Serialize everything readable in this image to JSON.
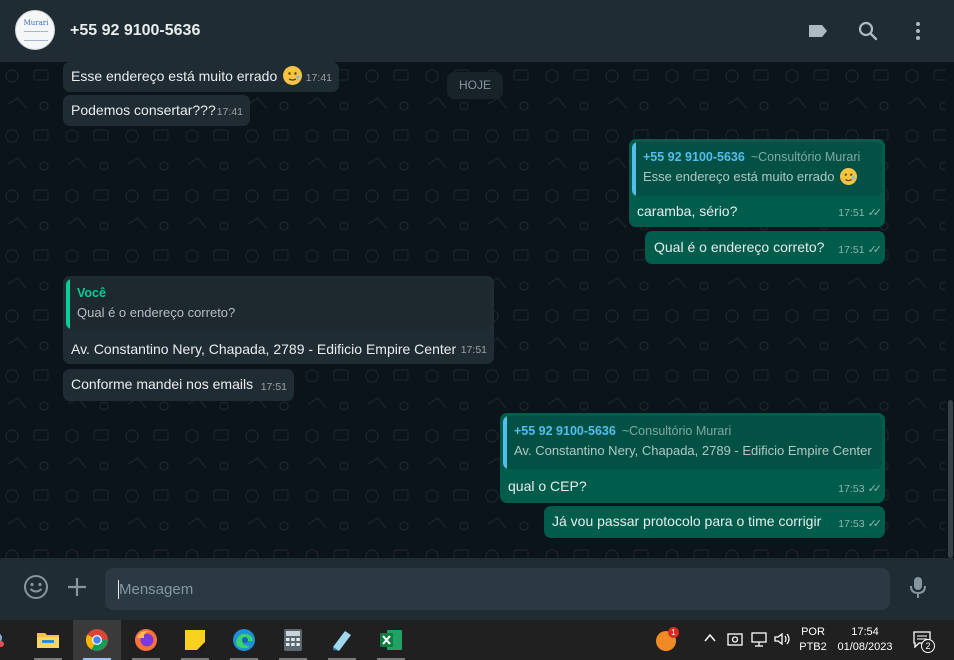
{
  "header": {
    "contact_name": "+55 92 9100-5636",
    "avatar_text": "Murari",
    "icons": [
      "label-icon",
      "search-icon",
      "menu-icon"
    ]
  },
  "chat": {
    "date_chip": "HOJE",
    "messages": [
      {
        "dir": "in",
        "text": "Esse endereço está muito errado",
        "emoji": "face-with-tear-icon",
        "time": "17:41"
      },
      {
        "dir": "in",
        "text": "Podemos consertar???",
        "time": "17:41"
      },
      {
        "dir": "out",
        "quote": {
          "author": "+55 92 9100-5636",
          "alias": "~Consultório Murari",
          "text": "Esse endereço está muito errado"
        },
        "text": "caramba, sério?",
        "time": "17:51",
        "status": "read"
      },
      {
        "dir": "out",
        "text": "Qual é o endereço correto?",
        "time": "17:51",
        "status": "read"
      },
      {
        "dir": "in",
        "quote": {
          "author": "Você",
          "text": "Qual é o endereço correto?"
        },
        "text": "Av. Constantino Nery, Chapada, 2789 - Edificio Empire Center",
        "time": "17:51"
      },
      {
        "dir": "in",
        "text": "Conforme mandei nos emails",
        "time": "17:51"
      },
      {
        "dir": "out",
        "quote": {
          "author": "+55 92 9100-5636",
          "alias": "~Consultório Murari",
          "text": "Av. Constantino Nery, Chapada, 2789 - Edificio Empire Center"
        },
        "text": "qual o CEP?",
        "time": "17:53",
        "status": "read"
      },
      {
        "dir": "out",
        "text": "Já vou passar protocolo para o time corrigir",
        "time": "17:53",
        "status": "read"
      }
    ]
  },
  "composer": {
    "placeholder": "Mensagem",
    "icons": [
      "emoji-icon",
      "attach-plus-icon",
      "microphone-icon"
    ]
  },
  "taskbar": {
    "apps": [
      "file-explorer-icon",
      "chrome-icon",
      "firefox-icon",
      "sticky-notes-icon",
      "edge-icon",
      "calculator-icon",
      "notepad-icon",
      "excel-icon"
    ],
    "notification_badge": "1",
    "language": "POR",
    "keyboard": "PTB2",
    "clock_time": "17:54",
    "clock_date": "01/08/2023",
    "action_center_count": "2"
  },
  "colors": {
    "incoming_bubble": "#202c33",
    "outgoing_bubble": "#005c4b",
    "header_bg": "#202c33",
    "chat_bg": "#0b141a",
    "accent_green": "#06cf9c",
    "accent_blue": "#53bdeb"
  }
}
